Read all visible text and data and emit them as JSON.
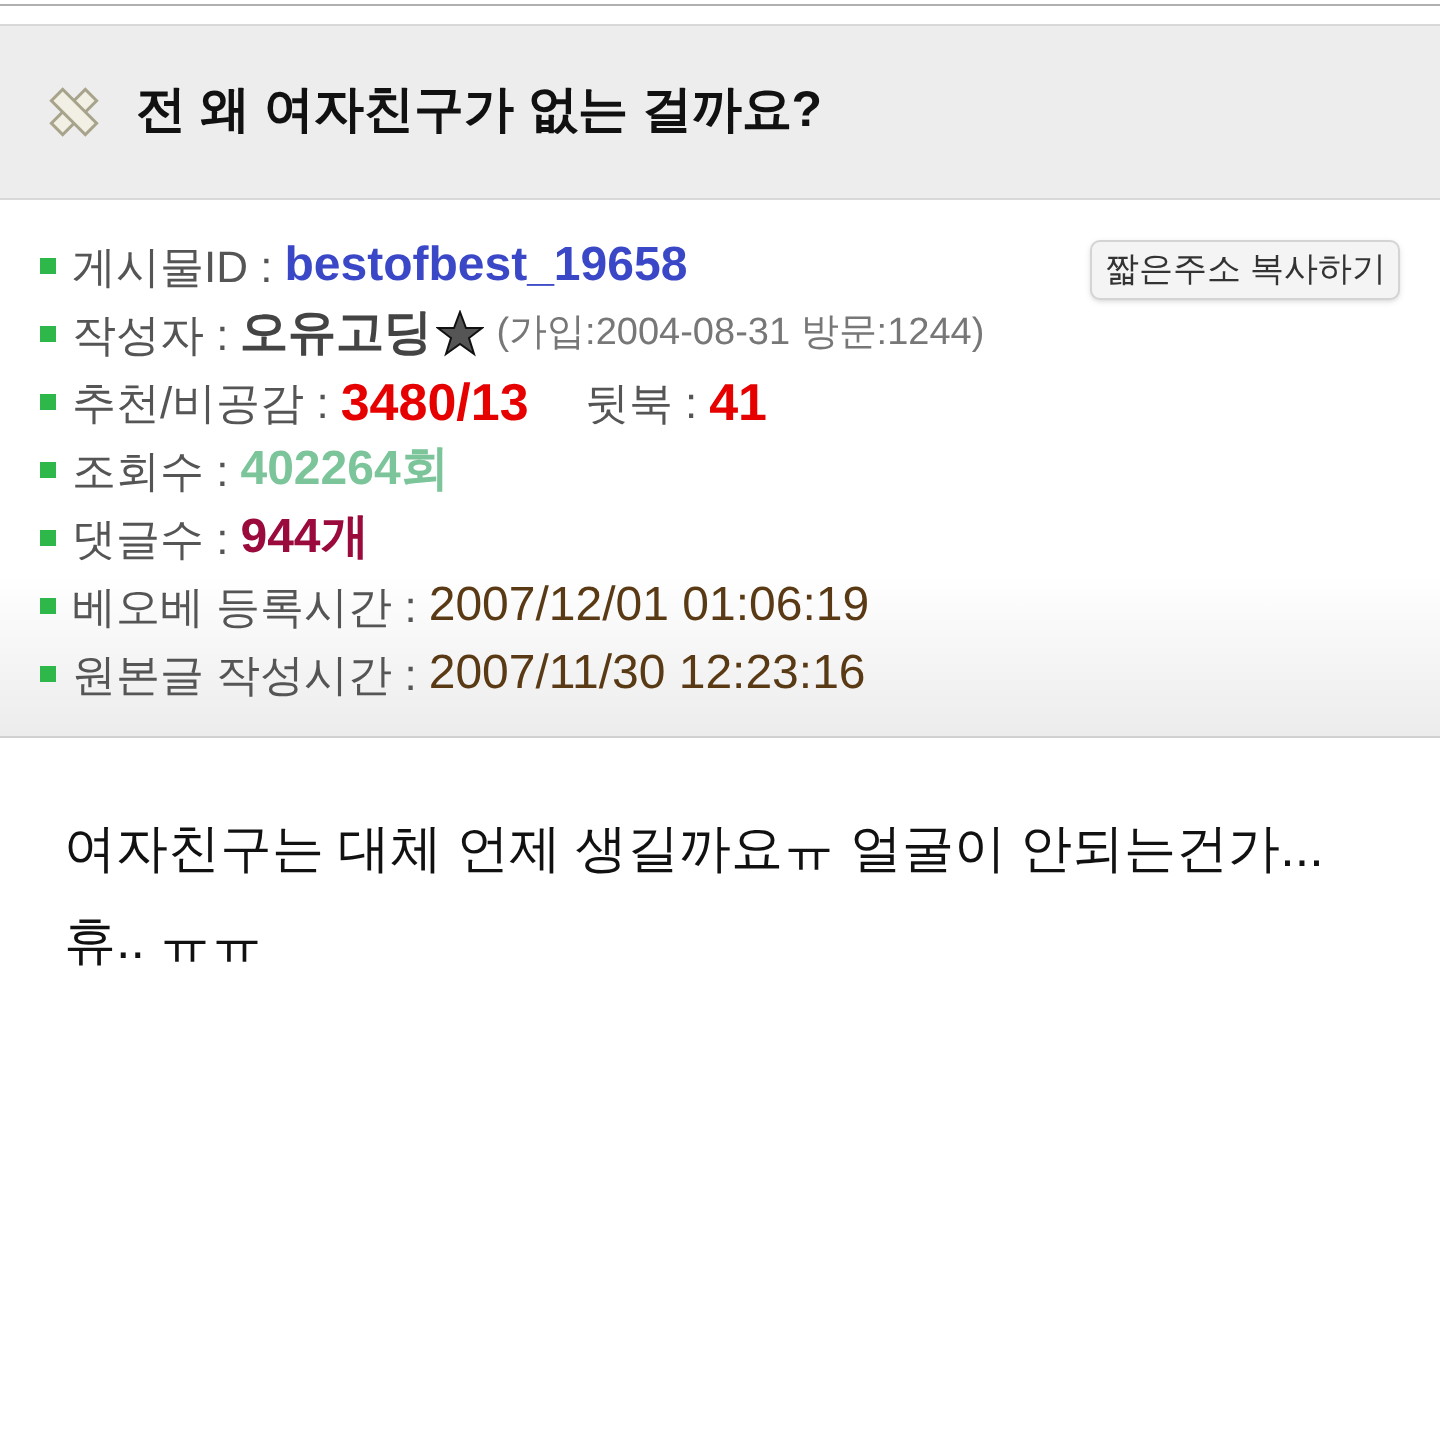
{
  "title": "전 왜 여자친구가 없는 걸까요?",
  "copy_button": "짧은주소 복사하기",
  "info_rows": [
    {
      "kind": "id",
      "label": "게시물ID :",
      "value": "bestofbest_19658"
    },
    {
      "kind": "author",
      "label": "작성자 :",
      "value": "오유고딩",
      "meta": "(가입:2004-08-31 방문:1244)"
    },
    {
      "kind": "votes",
      "label": "추천/비공감 :",
      "value": "3480/13",
      "label_2": "뒷북 :",
      "value_2": "41"
    },
    {
      "kind": "views",
      "label": "조회수 :",
      "value": "402264회"
    },
    {
      "kind": "comments",
      "label": "댓글수 :",
      "value": "944개"
    },
    {
      "kind": "time",
      "label": "베오베 등록시간 :",
      "value": "2007/12/01 01:06:19"
    },
    {
      "kind": "time",
      "label": "원본글 작성시간 :",
      "value": "2007/11/30 12:23:16"
    }
  ],
  "body": "여자친구는 대체 언제 생길까요ㅠ 얼굴이 안되는건가... 휴.. ㅠㅠ"
}
